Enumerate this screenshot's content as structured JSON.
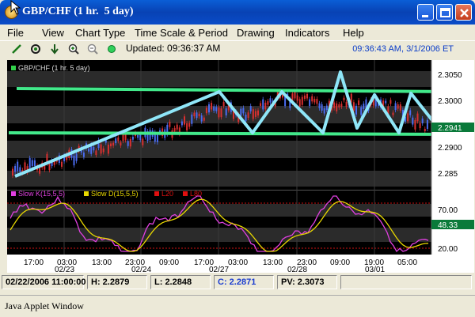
{
  "window": {
    "title": "GBP/CHF (1 hr.  5 day)"
  },
  "menu": [
    "File",
    "View",
    "Chart Type",
    "Time Scale & Period",
    "Drawing",
    "Indicators",
    "Help"
  ],
  "toolbar": {
    "tools": [
      "trend-line-icon",
      "crosshair-icon",
      "download-arrow-icon",
      "zoom-in-icon",
      "zoom-out-icon",
      "status-led-icon"
    ],
    "updated": "Updated: 09:36:37 AM",
    "clock": "09:36:43 AM, 3/1/2006 ET"
  },
  "chart": {
    "legend": "GBP/CHF (1 hr.  5 day)",
    "price_labels": [
      "2.3050",
      "2.3000",
      "2.2900",
      "2.285"
    ],
    "current_price": "2.2941",
    "osc_labels": [
      "70.00",
      "20.00"
    ],
    "osc_current": "48.33",
    "osc_legend": [
      "Slow K(15,5,5)",
      "Slow D(15,5,5)",
      "L20",
      "L80"
    ],
    "osc_colors": [
      "#e040e0",
      "#e8d800",
      "#e01010",
      "#e01010"
    ],
    "time_labels": [
      "17:00",
      "03:00",
      "13:00",
      "23:00",
      "09:00",
      "17:00",
      "03:00",
      "13:00",
      "23:00",
      "09:00",
      "19:00",
      "05:00"
    ],
    "date_labels": [
      "02/23",
      "02/24",
      "02/27",
      "02/28",
      "03/01"
    ]
  },
  "status": {
    "date": "02/22/2006 11:00:00",
    "high": "H: 2.2879",
    "low": "L: 2.2848",
    "close": "C: 2.2871",
    "pv": "PV: 2.3073"
  },
  "applet_label": "Java Applet Window"
}
